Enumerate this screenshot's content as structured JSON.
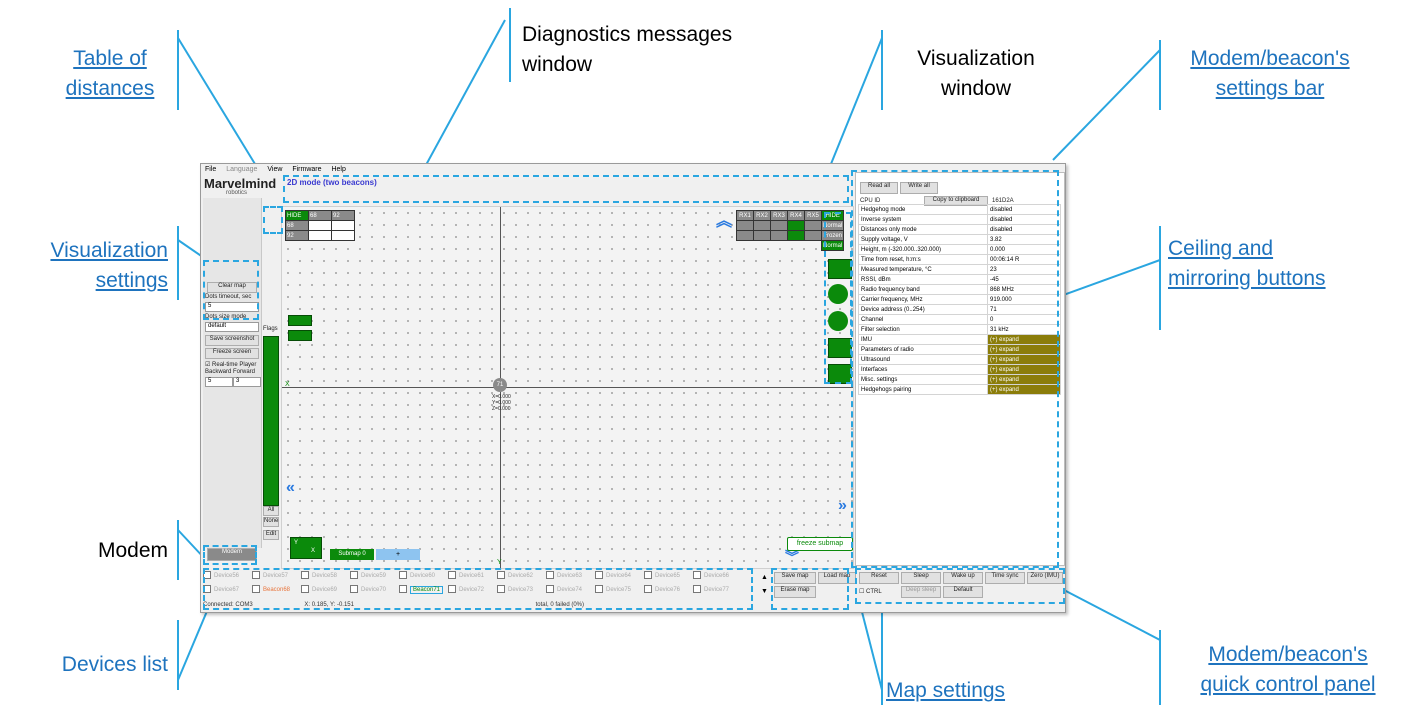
{
  "callouts": {
    "table_of_distances": "Table of\ndistances",
    "diagnostics": "Diagnostics messages\nwindow",
    "visualization_window": "Visualization\nwindow",
    "settings_bar": "Modem/beacon's\nsettings bar",
    "visualization_settings": "Visualization\nsettings",
    "ceiling_mirroring": "Ceiling and\nmirroring buttons",
    "modem": "Modem",
    "devices_list": "Devices list",
    "map_settings": "Map settings",
    "quick_control": "Modem/beacon's\nquick control panel"
  },
  "app": {
    "menu": [
      "File",
      "Language",
      "View",
      "Firmware",
      "Help"
    ],
    "logo": "Marvelmind",
    "logo_sub": "robotics",
    "mode_title": "2D mode (two beacons)",
    "left_panel": {
      "clear_map": "Clear map",
      "dots_timeout_label": "Dots timeout, sec",
      "dots_timeout_value": "5",
      "dots_size_label": "Dots size mode",
      "dots_size_value": "default",
      "save_screenshot": "Save screenshot",
      "freeze_screen": "Freeze screen",
      "realtime_player": "Real-time Player",
      "backward": "Backward",
      "forward": "Forward",
      "backward_value": "5",
      "forward_value": "3",
      "modem": "Modem",
      "flags_label": "Flags",
      "all_label": "All",
      "none_label": "None",
      "edit_label": "Edit"
    },
    "dist_table": {
      "header": [
        "HIDE",
        "68",
        "92"
      ],
      "rows": [
        [
          "68",
          "",
          ""
        ],
        [
          "92",
          "",
          ""
        ]
      ]
    },
    "rx_table": {
      "header": [
        "RX1",
        "RX2",
        "RX3",
        "RX4",
        "RX5",
        "HIDE"
      ],
      "right_labels": [
        "Normal",
        "Frozen",
        "Normal"
      ]
    },
    "plot": {
      "beacon_id": "71",
      "beacon_coords": "X=0.000\nY=0.000\nZ=0.000",
      "x_axis_label": "X",
      "y_axis_label": "Y",
      "freeze_submap": "freeze submap",
      "submap_label": "Submap 0",
      "submap_plus": "+",
      "axis_box_y": "Y",
      "axis_box_x": "X"
    },
    "settings": {
      "read_all": "Read all",
      "write_all": "Write all",
      "cpu_id": "CPU ID",
      "copy_clipboard": "Copy to clipboard",
      "cpu_value": "161D2A",
      "rows": [
        [
          "Hedgehog mode",
          "disabled",
          false
        ],
        [
          "Inverse system",
          "disabled",
          false
        ],
        [
          "Distances only mode",
          "disabled",
          false
        ],
        [
          "Supply voltage, V",
          "3.82",
          false
        ],
        [
          "Height, m (-320.000..320.000)",
          "0.000",
          false
        ],
        [
          "Time from reset, h:m:s",
          "00:06:14   R",
          false
        ],
        [
          "Measured temperature, °C",
          "23",
          false
        ],
        [
          "RSSI, dBm",
          "-45",
          false
        ],
        [
          "Radio frequency band",
          "868 MHz",
          false
        ],
        [
          "Carrier frequency, MHz",
          "919.000",
          false
        ],
        [
          "Device address (0..254)",
          "71",
          false
        ],
        [
          "Channel",
          "0",
          false
        ],
        [
          "Filter selection",
          "31 kHz",
          false
        ],
        [
          "IMU",
          "(+) expand",
          true
        ],
        [
          "Parameters of radio",
          "(+) expand",
          true
        ],
        [
          "Ultrasound",
          "(+) expand",
          true
        ],
        [
          "Interfaces",
          "(+) expand",
          true
        ],
        [
          "Misc. settings",
          "(+) expand",
          true
        ],
        [
          "Hedgehogs pairing",
          "(+) expand",
          true
        ]
      ]
    },
    "devices": {
      "row1": [
        "Device56",
        "Device57",
        "Device58",
        "Device59",
        "Device60",
        "Device61",
        "Device62",
        "Device63",
        "Device64",
        "Device65",
        "Device66"
      ],
      "row2": [
        "Device67",
        "Beacon68",
        "Device69",
        "Device70",
        "Beacon71",
        "Device72",
        "Device73",
        "Device74",
        "Device75",
        "Device76",
        "Device77"
      ]
    },
    "status": "Connected: COM3",
    "status_coords": "X: 0.185, Y: -0.151",
    "status_total": "total, 0 failed (0%)",
    "map_buttons": {
      "save": "Save map",
      "load": "Load map",
      "erase": "Erase map"
    },
    "quick": {
      "reset": "Reset",
      "sleep": "Sleep",
      "wake": "Wake up",
      "time_sync": "Time sync",
      "zero": "Zero (IMU)",
      "ctrl": "CTRL",
      "deep_sleep": "Deep sleep",
      "default": "Default"
    }
  },
  "colors": {
    "accent": "#2aa6e0",
    "link": "#1e73be",
    "green": "#0b8a0b",
    "expand": "#8b7d0a"
  }
}
